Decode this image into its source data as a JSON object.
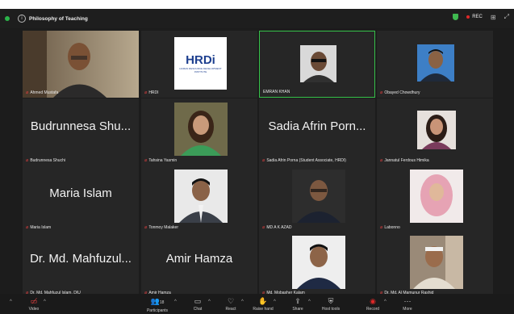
{
  "titlebar": {
    "meeting_title": "Philosophy of Teaching",
    "rec_label": "REC"
  },
  "participants": [
    {
      "name": "Ahmed Mustafa",
      "video": true
    },
    {
      "name": "HRDI",
      "video": true
    },
    {
      "name": "EMRAN KHAN",
      "video": true
    },
    {
      "name": "Obayed Chowdhury",
      "video": true
    },
    {
      "name": "Budrunnesa Shuchi",
      "display": "Budrunnesa Shu...",
      "video": false
    },
    {
      "name": "Tahsina Yasmin",
      "video": true
    },
    {
      "name": "Sadia Afrin Porna (Student Associate, HRDI)",
      "display": "Sadia Afrin Porn...",
      "video": false
    },
    {
      "name": "Jannatul Ferdous Himika",
      "video": true
    },
    {
      "name": "Maria Islam",
      "display": "Maria Islam",
      "video": false
    },
    {
      "name": "Tonmoy Malaker",
      "video": true
    },
    {
      "name": "MD A K AZAD",
      "video": true
    },
    {
      "name": "Labonno",
      "video": true
    },
    {
      "name": "Dr. Md. Mahfuzul Islam, DIU",
      "display": "Dr. Md. Mahfuzul...",
      "video": false
    },
    {
      "name": "Amir Hamza",
      "display": "Amir Hamza",
      "video": false
    },
    {
      "name": "Md. Mobasher Kalam",
      "video": true
    },
    {
      "name": "Dr. Md. Al Mamunur Rashid",
      "video": true
    }
  ],
  "hrdi_logo": {
    "text": "HRDi",
    "caption": "HUMAN RESOURCE DEVELOPMENT INSTITUTE"
  },
  "toolbar": {
    "video": "Video",
    "participants": "Participants",
    "participants_count": "18",
    "chat": "Chat",
    "react": "React",
    "raise_hand": "Raise hand",
    "share": "Share",
    "host_tools": "Host tools",
    "record": "Record",
    "more": "More"
  },
  "colors": {
    "active_border": "#36c24a",
    "mic_muted": "#e24141",
    "record": "#e02828"
  }
}
